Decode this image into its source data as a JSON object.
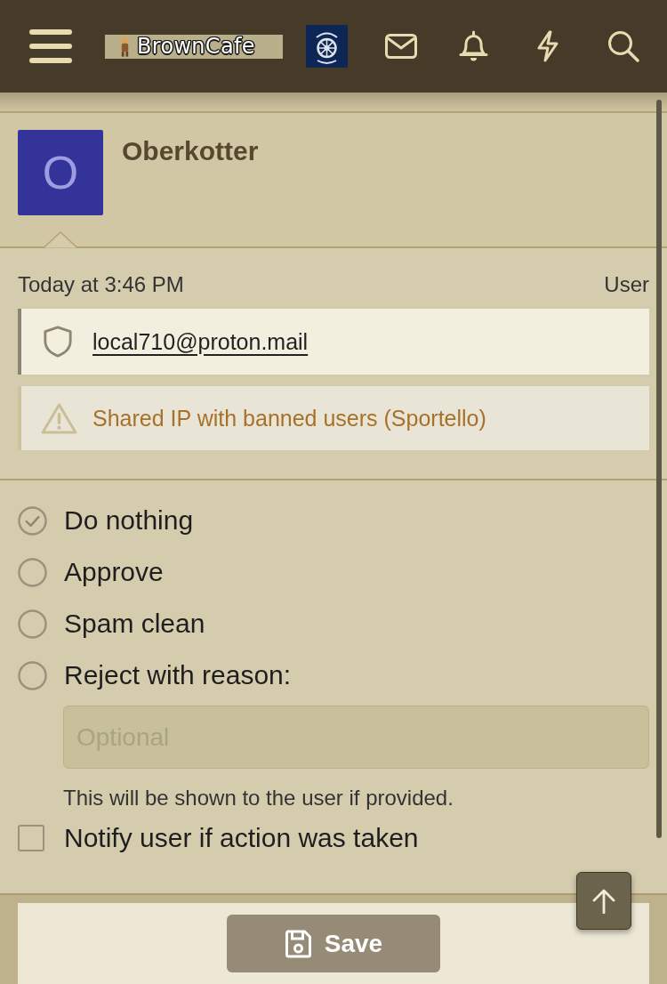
{
  "header": {
    "logo_text": "BrownCafe"
  },
  "user": {
    "avatar_letter": "O",
    "name": "Oberkotter"
  },
  "meta": {
    "time": "Today at 3:46 PM",
    "role": "User"
  },
  "notices": [
    {
      "kind": "email",
      "text": "local710@proton.mail"
    },
    {
      "kind": "warning",
      "text": "Shared IP with banned users (Sportello)"
    }
  ],
  "actions": [
    {
      "label": "Do nothing",
      "selected": true
    },
    {
      "label": "Approve",
      "selected": false
    },
    {
      "label": "Spam clean",
      "selected": false
    },
    {
      "label": "Reject with reason:",
      "selected": false
    }
  ],
  "reason_field": {
    "placeholder": "Optional"
  },
  "hint": "This will be shown to the user if provided.",
  "notify": {
    "label": "Notify user if action was taken",
    "checked": false
  },
  "save_button": {
    "label": "Save"
  }
}
